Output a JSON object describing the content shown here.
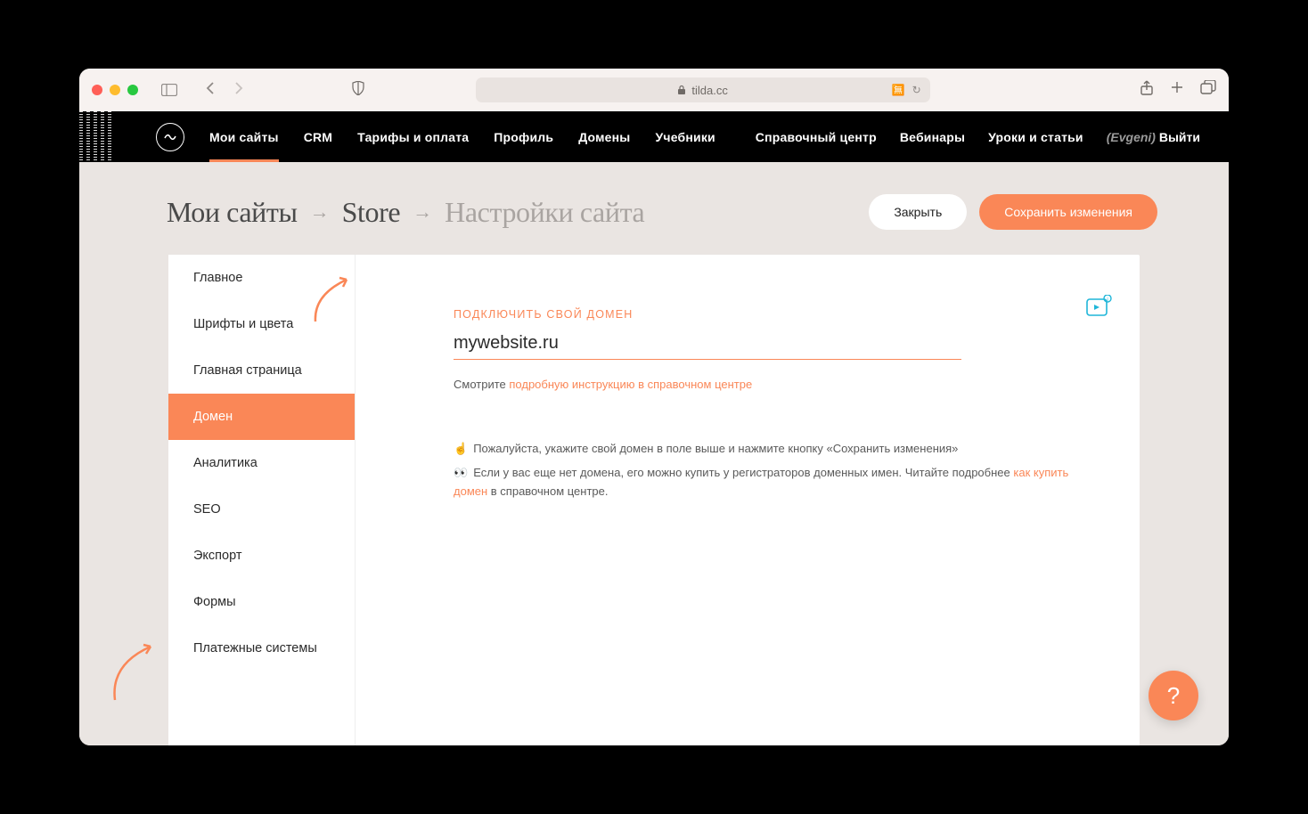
{
  "browser": {
    "url_host": "tilda.cc"
  },
  "nav": {
    "left": [
      "Мои сайты",
      "CRM",
      "Тарифы и оплата",
      "Профиль",
      "Домены",
      "Учебники"
    ],
    "active_index": 0,
    "right": [
      "Справочный центр",
      "Вебинары",
      "Уроки и статьи"
    ],
    "user_name": "(Evgeni)",
    "logout": "Выйти"
  },
  "breadcrumb": {
    "items": [
      "Мои сайты",
      "Store",
      "Настройки сайта"
    ]
  },
  "header_actions": {
    "close": "Закрыть",
    "save": "Сохранить изменения"
  },
  "sidebar": {
    "items": [
      "Главное",
      "Шрифты и цвета",
      "Главная страница",
      "Домен",
      "Аналитика",
      "SEO",
      "Экспорт",
      "Формы",
      "Платежные системы"
    ],
    "active_index": 3
  },
  "domain_panel": {
    "section_label": "ПОДКЛЮЧИТЬ СВОЙ ДОМЕН",
    "value": "mywebsite.ru",
    "help_prefix": "Смотрите ",
    "help_link": "подробную инструкцию в справочном центре",
    "note1_emoji": "☝",
    "note1_text": "Пожалуйста, укажите свой домен в поле выше и нажмите кнопку «Сохранить изменения»",
    "note2_emoji": "👀",
    "note2_prefix": "Если у вас еще нет домена, его можно купить у регистраторов доменных имен. Читайте подробнее ",
    "note2_link": "как купить домен",
    "note2_suffix": " в справочном центре."
  },
  "help_fab": "?"
}
